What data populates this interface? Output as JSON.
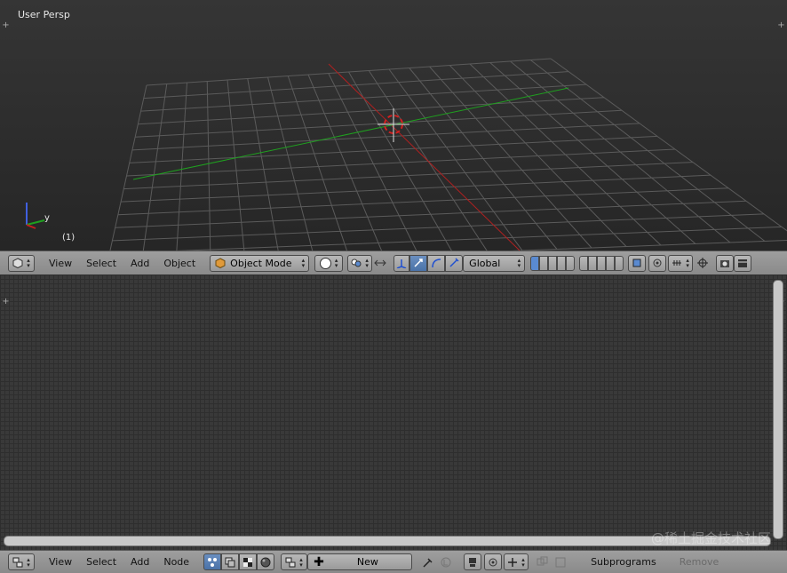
{
  "viewport": {
    "view_label": "User Persp",
    "frame_label": "(1)",
    "axis_y_label": "y"
  },
  "header_3d": {
    "menus": [
      "View",
      "Select",
      "Add",
      "Object"
    ],
    "mode": "Object Mode",
    "orientation": "Global"
  },
  "node_editor": {},
  "header_node": {
    "menus": [
      "View",
      "Select",
      "Add",
      "Node"
    ],
    "new_label": "New",
    "subprograms_label": "Subprograms",
    "remove_label": "Remove"
  },
  "watermark": "@稀土掘金技术社区",
  "colors": {
    "x_axis": "#b02020",
    "y_axis": "#1fa01f",
    "cursor": "#d42020",
    "active_tool": "#4a72a8"
  }
}
